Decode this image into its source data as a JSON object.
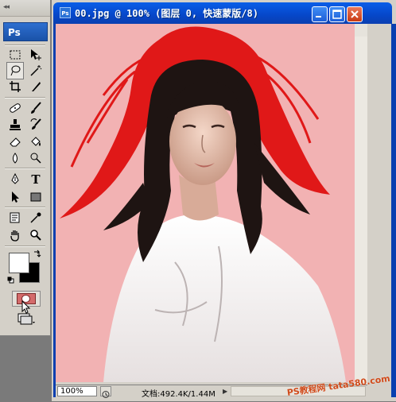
{
  "toolbox": {
    "grip": "◂◂",
    "logo": "Ps",
    "tools": [
      {
        "name": "marquee-tool",
        "icon": "marquee-icon"
      },
      {
        "name": "move-tool",
        "icon": "move-icon"
      },
      {
        "name": "lasso-tool",
        "icon": "lasso-icon",
        "selected": true
      },
      {
        "name": "magic-wand-tool",
        "icon": "magic-wand-icon"
      },
      {
        "name": "crop-tool",
        "icon": "crop-icon"
      },
      {
        "name": "slice-tool",
        "icon": "slice-icon"
      },
      {
        "name": "healing-brush-tool",
        "icon": "bandage-icon"
      },
      {
        "name": "brush-tool",
        "icon": "brush-icon"
      },
      {
        "name": "clone-stamp-tool",
        "icon": "stamp-icon"
      },
      {
        "name": "history-brush-tool",
        "icon": "history-brush-icon"
      },
      {
        "name": "eraser-tool",
        "icon": "eraser-icon"
      },
      {
        "name": "paint-bucket-tool",
        "icon": "bucket-icon"
      },
      {
        "name": "blur-tool",
        "icon": "drop-icon"
      },
      {
        "name": "dodge-tool",
        "icon": "dodge-icon"
      },
      {
        "name": "pen-tool",
        "icon": "pen-icon"
      },
      {
        "name": "type-tool",
        "icon": "type-icon",
        "glyph": "T"
      },
      {
        "name": "path-selection-tool",
        "icon": "arrow-icon"
      },
      {
        "name": "shape-tool",
        "icon": "rectangle-icon"
      },
      {
        "name": "notes-tool",
        "icon": "note-icon"
      },
      {
        "name": "eyedropper-tool",
        "icon": "eyedropper-icon"
      },
      {
        "name": "hand-tool",
        "icon": "hand-icon"
      },
      {
        "name": "zoom-tool",
        "icon": "zoom-icon"
      }
    ],
    "foreground_color": "#ffffff",
    "background_color": "#000000",
    "quick_mask_color": "#d46b6b"
  },
  "document": {
    "title": "00.jpg @ 100% (图层 0, 快速蒙版/8)",
    "title_icon": "Ps",
    "zoom": "100%",
    "doc_info": "文档:492.4K/1.44M",
    "watermark": "PS教程网 tata580.com",
    "mask_overlay_color": "#f2b2b3",
    "mask_paint_color": "#e01818"
  }
}
